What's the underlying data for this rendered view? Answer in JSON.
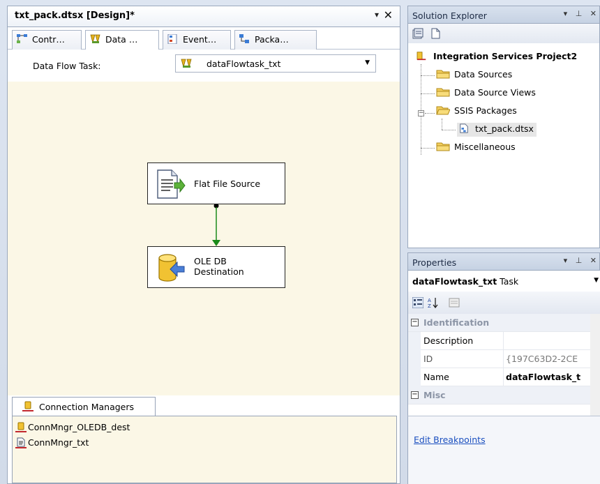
{
  "designer": {
    "doc_tab_title": "txt_pack.dtsx [Design]*",
    "pin_glyph": "▾",
    "close_glyph": "✕",
    "tabs": [
      {
        "label": "Contr…"
      },
      {
        "label": "Data …"
      },
      {
        "label": "Event…"
      },
      {
        "label": "Packa…"
      }
    ],
    "task_label": "Data Flow Task:",
    "task_value": "dataFlowtask_txt",
    "nodes": {
      "source": "Flat File Source",
      "destination_line1": "OLE DB",
      "destination_line2": "Destination"
    },
    "connection_managers": {
      "tab_label": "Connection Managers",
      "items": [
        "ConnMngr_OLEDB_dest",
        "ConnMngr_txt"
      ]
    }
  },
  "solution_explorer": {
    "title": "Solution Explorer",
    "root": "Integration Services Project2",
    "items": {
      "data_sources": "Data Sources",
      "data_source_views": "Data Source Views",
      "ssis_packages": "SSIS Packages",
      "package_file": "txt_pack.dtsx",
      "miscellaneous": "Miscellaneous"
    }
  },
  "properties": {
    "title": "Properties",
    "object_name": "dataFlowtask_txt",
    "object_type": "Task",
    "categories": {
      "identification": "Identification",
      "misc": "Misc"
    },
    "rows": {
      "description_name": "Description",
      "description_value": "",
      "id_name": "ID",
      "id_value": "{197C63D2-2CE",
      "name_name": "Name",
      "name_value": "dataFlowtask_t"
    },
    "link": "Edit Breakpoints"
  },
  "colors": {
    "canvas": "#fbf7e6",
    "flow_line": "#1a8a1a",
    "link": "#1a4fbf"
  }
}
